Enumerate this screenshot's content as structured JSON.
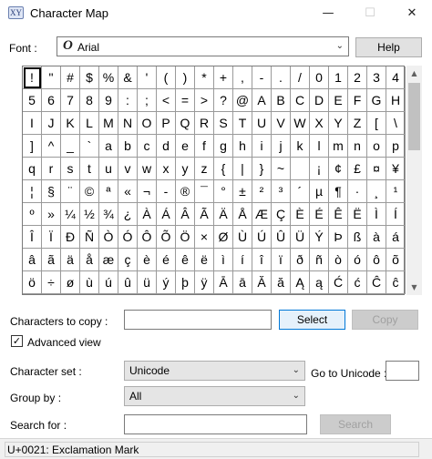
{
  "window": {
    "title": "Character Map",
    "app_icon_text": "XY",
    "minimize_glyph": "—",
    "maximize_glyph": "☐",
    "close_glyph": "✕"
  },
  "font_row": {
    "label": "Font :",
    "selected_font": "Arial",
    "font_icon": "O",
    "help_label": "Help"
  },
  "char_grid": {
    "selected_index": 0,
    "rows": [
      [
        "!",
        "\"",
        "#",
        "$",
        "%",
        "&",
        "'",
        "(",
        ")",
        "*",
        "+",
        ",",
        "-",
        ".",
        "/",
        "0",
        "1",
        "2",
        "3",
        "4"
      ],
      [
        "5",
        "6",
        "7",
        "8",
        "9",
        ":",
        ";",
        "<",
        "=",
        ">",
        "?",
        "@",
        "A",
        "B",
        "C",
        "D",
        "E",
        "F",
        "G",
        "H"
      ],
      [
        "I",
        "J",
        "K",
        "L",
        "M",
        "N",
        "O",
        "P",
        "Q",
        "R",
        "S",
        "T",
        "U",
        "V",
        "W",
        "X",
        "Y",
        "Z",
        "[",
        "\\"
      ],
      [
        "]",
        "^",
        "_",
        "`",
        "a",
        "b",
        "c",
        "d",
        "e",
        "f",
        "g",
        "h",
        "i",
        "j",
        "k",
        "l",
        "m",
        "n",
        "o",
        "p"
      ],
      [
        "q",
        "r",
        "s",
        "t",
        "u",
        "v",
        "w",
        "x",
        "y",
        "z",
        "{",
        "|",
        "}",
        "~",
        "",
        "¡",
        "¢",
        "£",
        "¤",
        "¥"
      ],
      [
        "¦",
        "§",
        "¨",
        "©",
        "ª",
        "«",
        "¬",
        "-",
        "®",
        "¯",
        "°",
        "±",
        "²",
        "³",
        "´",
        "µ",
        "¶",
        "·",
        "¸",
        "¹"
      ],
      [
        "º",
        "»",
        "¼",
        "½",
        "¾",
        "¿",
        "À",
        "Á",
        "Â",
        "Ã",
        "Ä",
        "Å",
        "Æ",
        "Ç",
        "È",
        "É",
        "Ê",
        "Ë",
        "Ì",
        "Í"
      ],
      [
        "Î",
        "Ï",
        "Ð",
        "Ñ",
        "Ò",
        "Ó",
        "Ô",
        "Õ",
        "Ö",
        "×",
        "Ø",
        "Ù",
        "Ú",
        "Û",
        "Ü",
        "Ý",
        "Þ",
        "ß",
        "à",
        "á"
      ],
      [
        "â",
        "ã",
        "ä",
        "å",
        "æ",
        "ç",
        "è",
        "é",
        "ê",
        "ë",
        "ì",
        "í",
        "î",
        "ï",
        "ð",
        "ñ",
        "ò",
        "ó",
        "ô",
        "õ"
      ],
      [
        "ö",
        "÷",
        "ø",
        "ù",
        "ú",
        "û",
        "ü",
        "ý",
        "þ",
        "ÿ",
        "Ā",
        "ā",
        "Ă",
        "ă",
        "Ą",
        "ą",
        "Ć",
        "ć",
        "Ĉ",
        "ĉ"
      ]
    ]
  },
  "scrollbar": {
    "up_glyph": "▲",
    "down_glyph": "▼"
  },
  "copy_row": {
    "label": "Characters to copy :",
    "value": "",
    "select_label": "Select",
    "copy_label": "Copy"
  },
  "advanced": {
    "label": "Advanced view",
    "checked_glyph": "✓"
  },
  "charset": {
    "label": "Character set :",
    "value": "Unicode",
    "goto_label": "Go to Unicode :",
    "goto_value": ""
  },
  "group_by": {
    "label": "Group by :",
    "value": "All"
  },
  "search": {
    "label": "Search for :",
    "value": "",
    "button_label": "Search"
  },
  "status": {
    "text": "U+0021: Exclamation Mark"
  },
  "dropdown_arrow": "⌄"
}
